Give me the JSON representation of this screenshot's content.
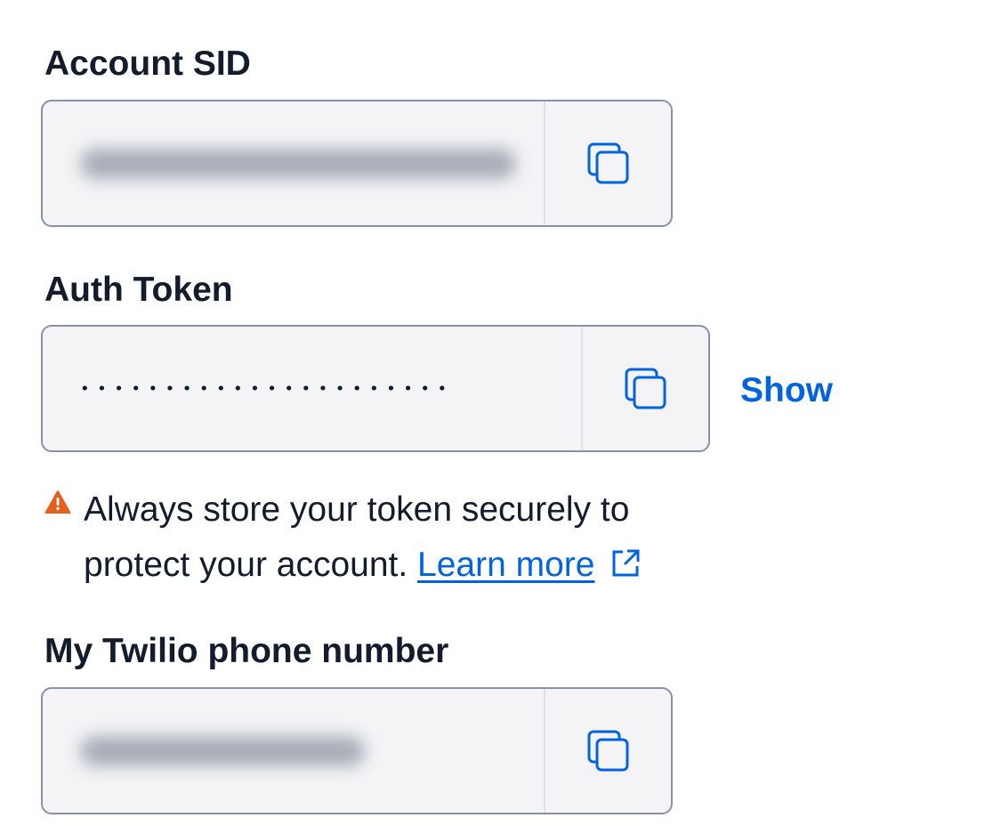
{
  "account_sid": {
    "label": "Account SID"
  },
  "auth_token": {
    "label": "Auth Token",
    "masked_value": "••••••••••••••••••••••",
    "show_label": "Show"
  },
  "warning": {
    "line1": "Always store your token securely to",
    "line2": "protect your account.",
    "link_text": "Learn more"
  },
  "phone_number": {
    "label": "My Twilio phone number"
  },
  "icons": {
    "copy": "copy-icon",
    "warning": "warning-triangle-icon",
    "external_link": "external-link-icon"
  },
  "colors": {
    "text": "#121c2d",
    "link": "#0263e0",
    "warning": "#e25f1d",
    "field_bg": "#f4f4f6",
    "field_border": "#8891aa"
  }
}
